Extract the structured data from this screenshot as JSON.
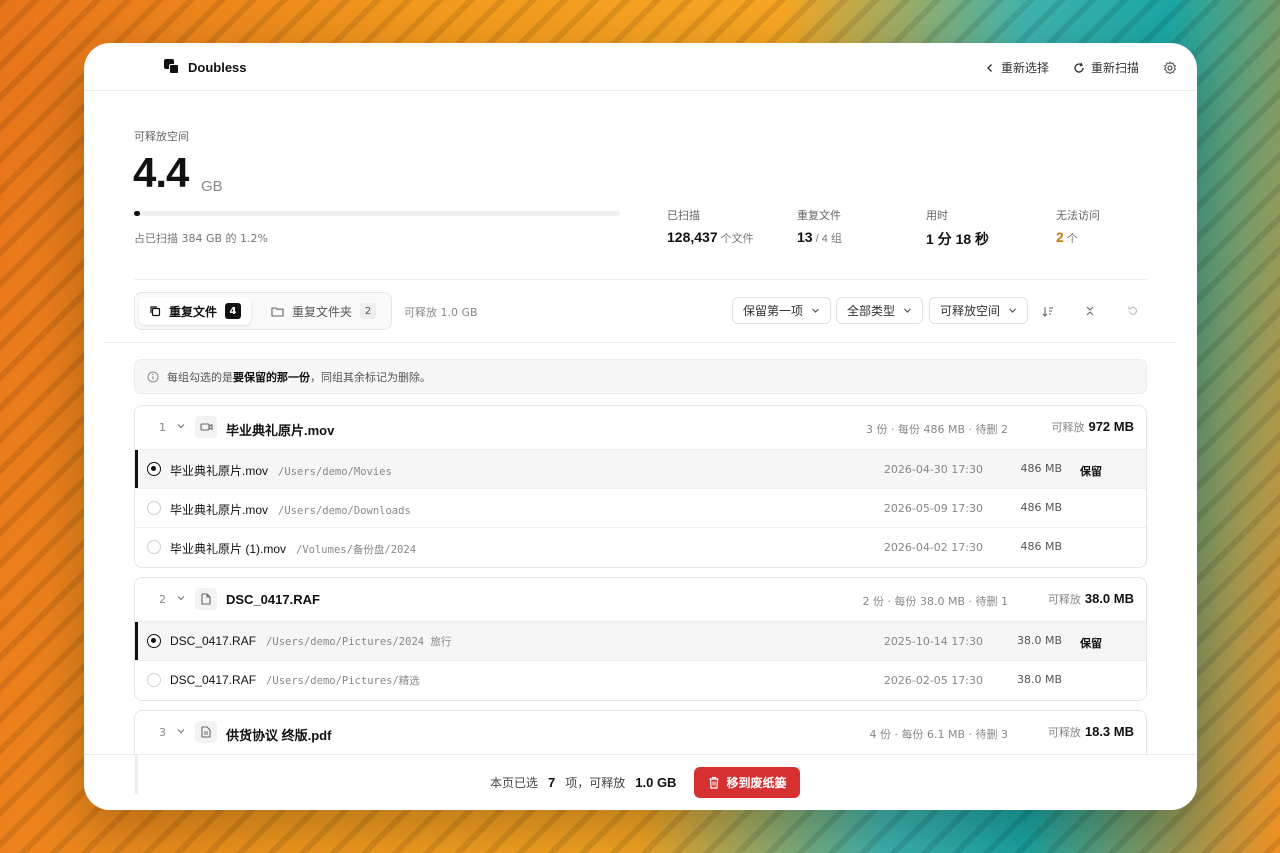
{
  "app": {
    "title": "Doubless"
  },
  "top_actions": {
    "reselect": "重新选择",
    "rescan": "重新扫描"
  },
  "summary": {
    "label": "可释放空间",
    "value": "4.4",
    "unit": "GB",
    "progress_fraction": 0.012,
    "note": "占已扫描 384 GB 的 1.2%"
  },
  "stats": [
    {
      "label": "已扫描",
      "value": "128,437",
      "unit": "个文件"
    },
    {
      "label": "重复文件",
      "value": "13",
      "unit": "/ 4 组"
    },
    {
      "label": "用时",
      "value": "1 分 18 秒",
      "unit": ""
    },
    {
      "label": "无法访问",
      "value": "2",
      "unit": "个"
    }
  ],
  "tabs": [
    {
      "label": "重复文件",
      "count": "4"
    },
    {
      "label": "重复文件夹",
      "count": "2"
    }
  ],
  "tab_freeable": "可释放 1.0 GB",
  "filters": {
    "keep": "保留第一项",
    "type": "全部类型",
    "sort": "可释放空间"
  },
  "info": {
    "prefix": "每组勾选的是",
    "emphasis": "要保留的那一份",
    "suffix": "，同组其余标记为删除。"
  },
  "groups": [
    {
      "index": "1",
      "name": "毕业典礼原片.mov",
      "meta": "3 份 · 每份 486 MB · 待删 2",
      "free_label": "可释放",
      "free_value": "972 MB",
      "rows": [
        {
          "name": "毕业典礼原片.mov",
          "path": "/Users/demo/Movies",
          "date": "2026-04-30 17:30",
          "size": "486 MB",
          "keep": "保留",
          "kept": true
        },
        {
          "name": "毕业典礼原片.mov",
          "path": "/Users/demo/Downloads",
          "date": "2026-05-09 17:30",
          "size": "486 MB",
          "keep": "",
          "kept": false
        },
        {
          "name": "毕业典礼原片 (1).mov",
          "path": "/Volumes/备份盘/2024",
          "date": "2026-04-02 17:30",
          "size": "486 MB",
          "keep": "",
          "kept": false
        }
      ]
    },
    {
      "index": "2",
      "name": "DSC_0417.RAF",
      "meta": "2 份 · 每份 38.0 MB · 待删 1",
      "free_label": "可释放",
      "free_value": "38.0 MB",
      "rows": [
        {
          "name": "DSC_0417.RAF",
          "path": "/Users/demo/Pictures/2024 旅行",
          "date": "2025-10-14 17:30",
          "size": "38.0 MB",
          "keep": "保留",
          "kept": true
        },
        {
          "name": "DSC_0417.RAF",
          "path": "/Users/demo/Pictures/精选",
          "date": "2026-02-05 17:30",
          "size": "38.0 MB",
          "keep": "",
          "kept": false
        }
      ]
    },
    {
      "index": "3",
      "name": "供货协议 终版.pdf",
      "meta": "4 份 · 每份 6.1 MB · 待删 3",
      "free_label": "可释放",
      "free_value": "18.3 MB",
      "rows": []
    }
  ],
  "bottom": {
    "prefix": "本页已选",
    "count": "7",
    "mid": "项，可释放",
    "size": "1.0 GB",
    "button": "移到废纸篓"
  },
  "colors": {
    "accent": "#d63031",
    "warn": "#c47a10",
    "text": "#111111"
  }
}
